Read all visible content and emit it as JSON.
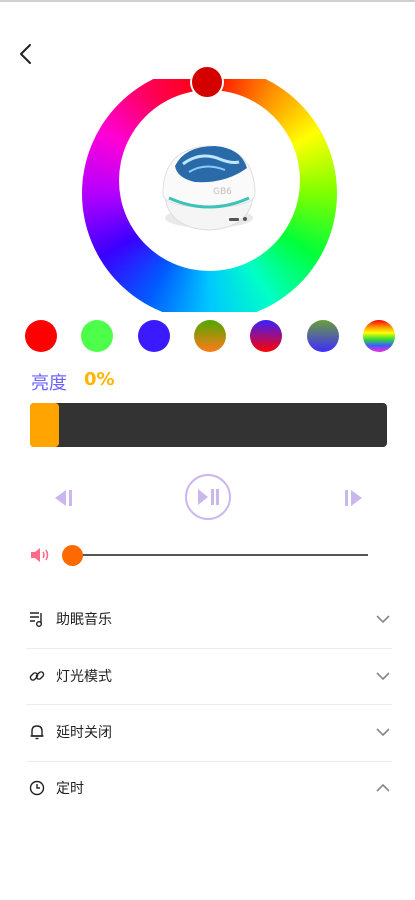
{
  "brightness": {
    "label": "亮度",
    "value_text": "0%",
    "level": 0.0
  },
  "volume": {
    "level": 0.0
  },
  "swatches": [
    "red",
    "green",
    "blue",
    "green-orange",
    "blue-red",
    "green-blue",
    "rainbow"
  ],
  "menu": {
    "items": [
      {
        "label": "助眠音乐",
        "icon": "music-note-icon",
        "expanded": false
      },
      {
        "label": "灯光模式",
        "icon": "link-icon",
        "expanded": false
      },
      {
        "label": "延时关闭",
        "icon": "bell-icon",
        "expanded": false
      },
      {
        "label": "定时",
        "icon": "clock-icon",
        "expanded": true
      }
    ]
  },
  "colors": {
    "brightness_label": "#6b63ff",
    "brightness_value": "#ffb400",
    "bar_fill": "#ffa400",
    "volume_thumb": "#ff6a00",
    "selected_color": "#d40000"
  },
  "product": {
    "logo_text": "GB6"
  }
}
